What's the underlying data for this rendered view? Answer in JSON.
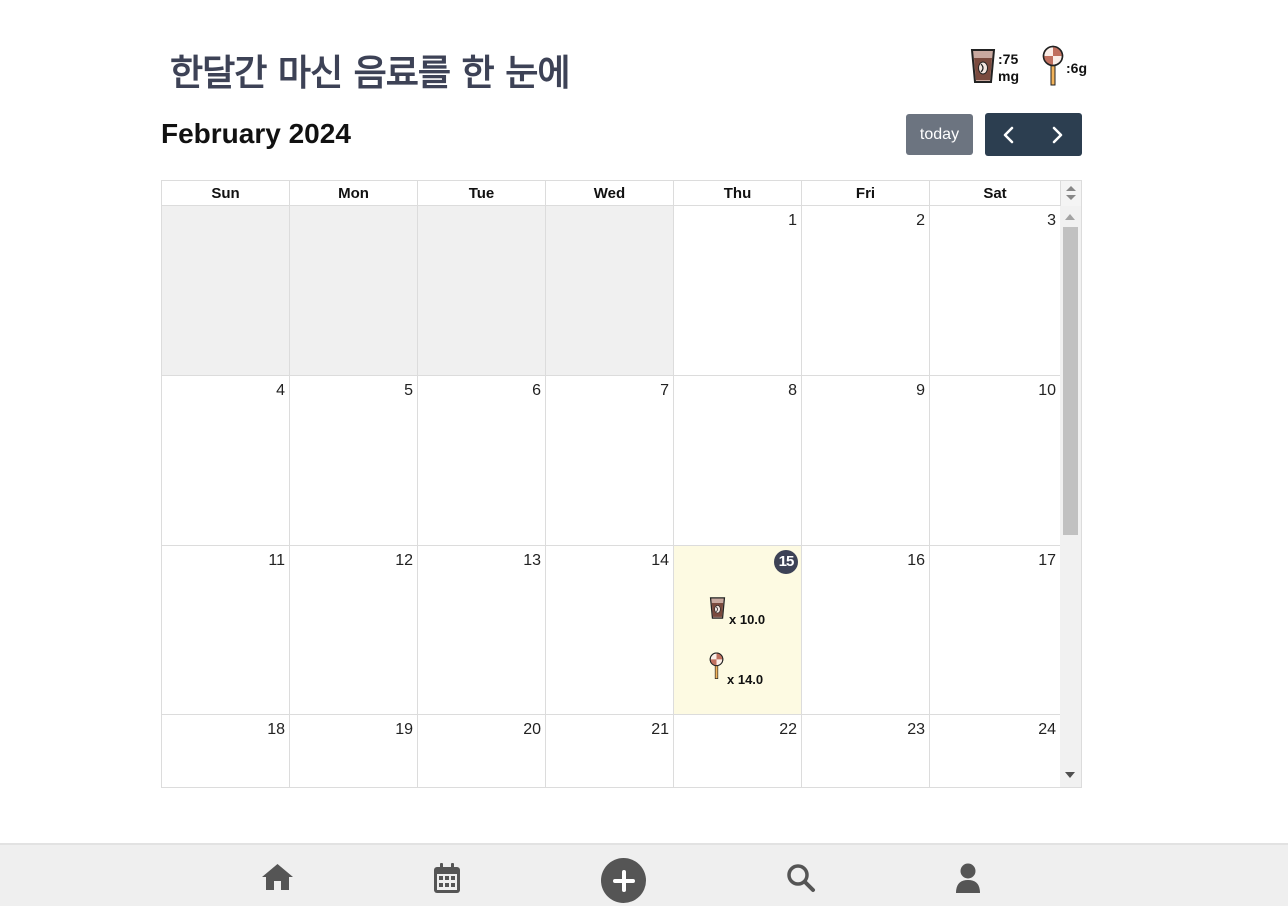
{
  "header": {
    "title": "한달간 마신 음료를 한 눈에",
    "legend": {
      "caffeine_label": ":75\nmg",
      "caffeine_value": ":75",
      "caffeine_unit": "mg",
      "sugar_label": ":6g"
    }
  },
  "calendar": {
    "month_title": "February 2024",
    "today_label": "today",
    "weekdays": [
      "Sun",
      "Mon",
      "Tue",
      "Wed",
      "Thu",
      "Fri",
      "Sat"
    ],
    "days": [
      "",
      "",
      "",
      "",
      "1",
      "2",
      "3",
      "4",
      "5",
      "6",
      "7",
      "8",
      "9",
      "10",
      "11",
      "12",
      "13",
      "14",
      "15",
      "16",
      "17",
      "18",
      "19",
      "20",
      "21",
      "22",
      "23",
      "24"
    ],
    "today": "15",
    "events": {
      "caffeine_count": "x 10.0",
      "sugar_count": "x 14.0"
    }
  },
  "colors": {
    "accent": "#2c3e50",
    "today_bg": "#fdfae2",
    "today_badge": "#3d4256",
    "title": "#3d4256"
  },
  "nav": {
    "items": [
      "home-icon",
      "calendar-icon",
      "add-icon",
      "search-icon",
      "user-icon"
    ]
  }
}
